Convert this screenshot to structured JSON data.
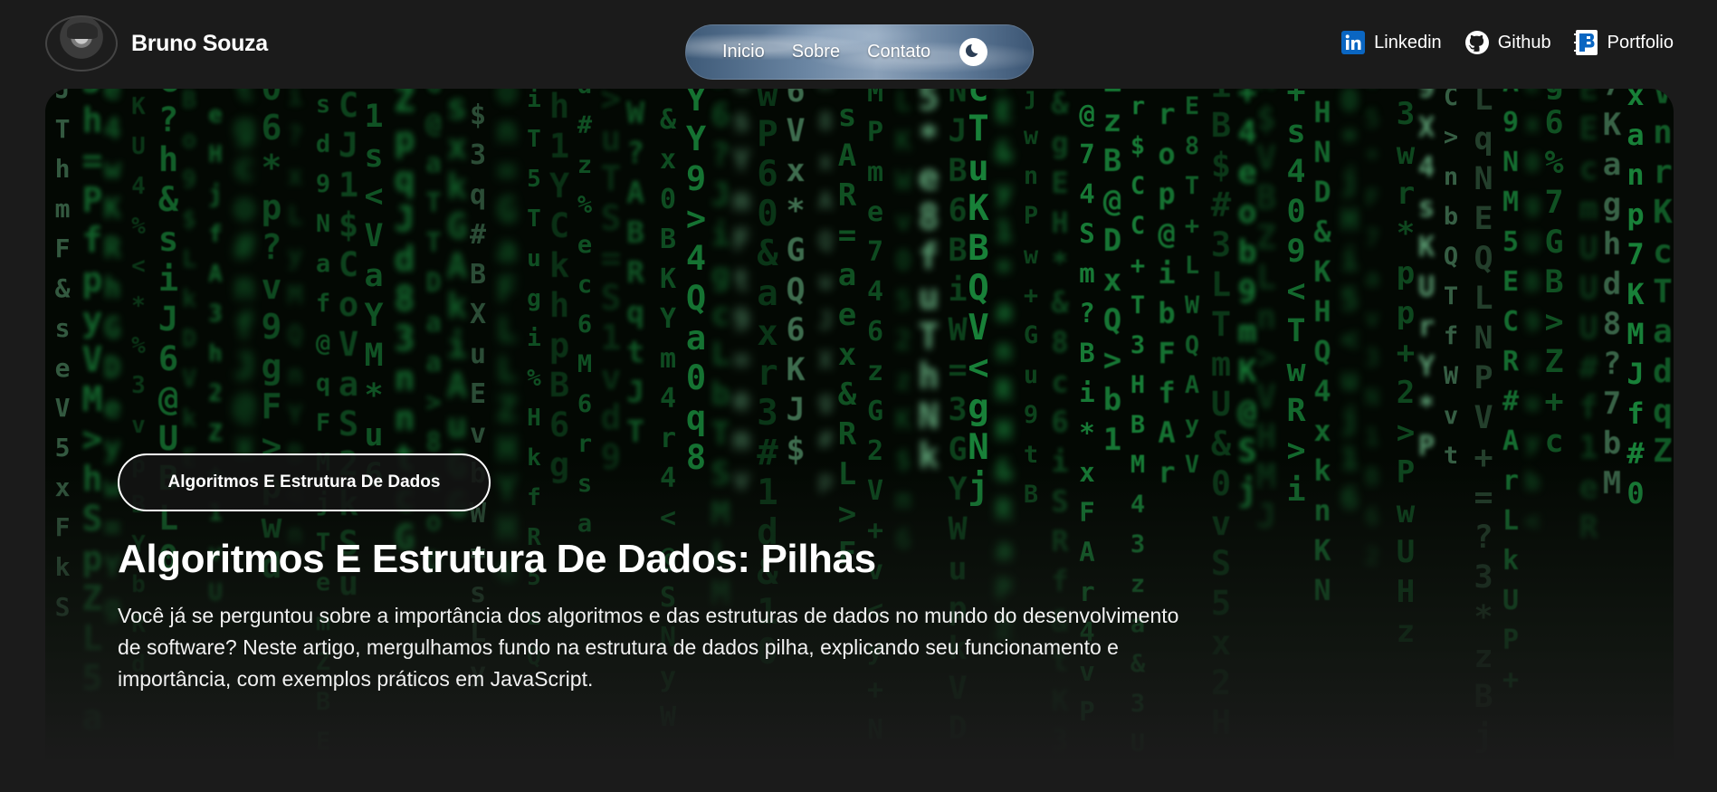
{
  "header": {
    "brand_name": "Bruno Souza",
    "nav": [
      {
        "label": "Inicio"
      },
      {
        "label": "Sobre"
      },
      {
        "label": "Contato"
      }
    ],
    "theme_toggle_icon": "moon-icon",
    "social": [
      {
        "label": "Linkedin",
        "icon": "linkedin-icon"
      },
      {
        "label": "Github",
        "icon": "github-icon"
      },
      {
        "label": "Portfolio",
        "icon": "portfolio-icon"
      }
    ]
  },
  "hero": {
    "tag": "Algoritmos E Estrutura De Dados",
    "title": "Algoritmos E Estrutura De Dados: Pilhas",
    "description": "Você já se perguntou sobre a importância dos algoritmos e das estruturas de dados no mundo do desenvolvimento de software? Neste artigo, mergulhamos fundo na estrutura de dados pilha, explicando seu funcionamento e importância, com exemplos práticos em JavaScript."
  },
  "colors": {
    "background": "#1b1b1b",
    "matrix_green": "#1fa84a",
    "linkedin_blue": "#0a66c2"
  }
}
